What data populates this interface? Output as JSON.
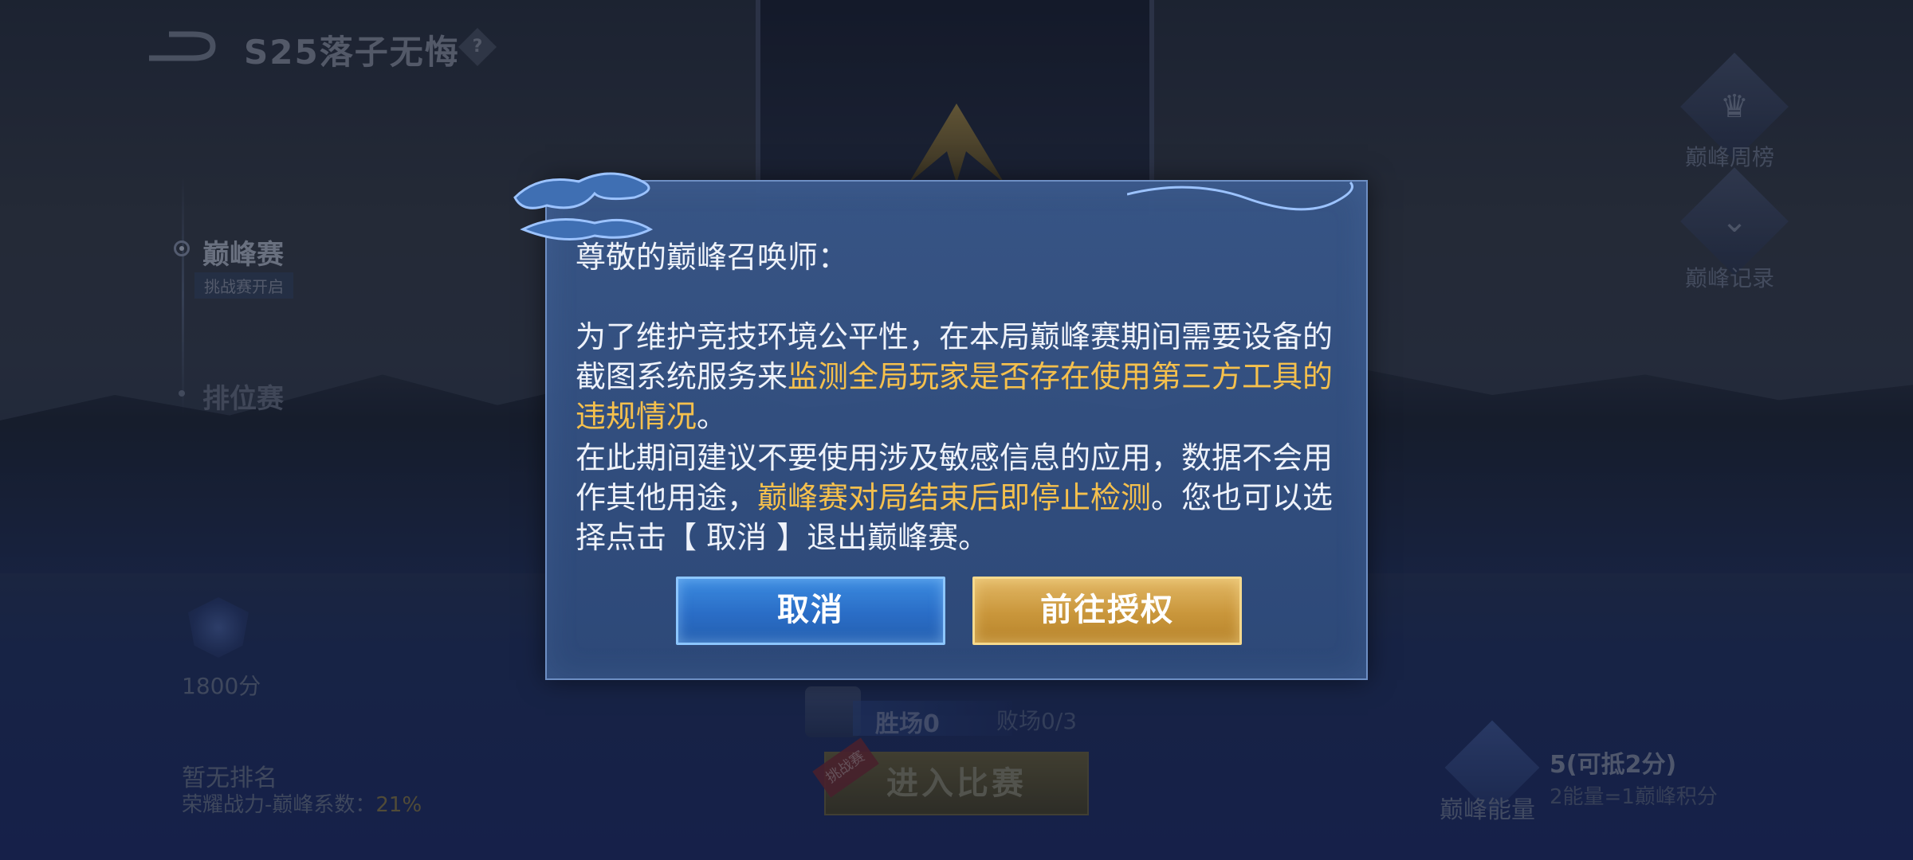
{
  "header": {
    "season_title": "S25落子无悔",
    "help_glyph": "?"
  },
  "modes": {
    "peak": "巅峰赛",
    "peak_sub": "挑战赛开启",
    "ranked": "排位赛"
  },
  "profile": {
    "score": "1800分",
    "no_rank": "暂无排名",
    "power_label": "荣耀战力-巅峰系数：",
    "power_pct": "21%"
  },
  "right_panel": {
    "weekly": "巅峰周榜",
    "record": "巅峰记录"
  },
  "match": {
    "wins": "胜场0",
    "losses": "败场0/3",
    "enter_label": "进入比赛",
    "challenge_tag": "挑战赛"
  },
  "energy": {
    "label": "巅峰能量",
    "value": "5(可抵2分)",
    "rule": "2能量=1巅峰积分"
  },
  "dialog": {
    "salutation": "尊敬的巅峰召唤师：",
    "p1_a": "为了维护竞技环境公平性，在本局巅峰赛期间需要设备的截图系统服务来",
    "p1_hl": "监测全局玩家是否存在使用第三方工具的违规情况",
    "p1_b": "。",
    "p2_a": "在此期间建议不要使用涉及敏感信息的应用，数据不会用作其他用途，",
    "p2_hl": "巅峰赛对局结束后即停止检测",
    "p2_b": "。您也可以选择点击【 取消 】退出巅峰赛。",
    "cancel_label": "取消",
    "auth_label": "前往授权"
  },
  "colors": {
    "highlight": "#f5c04d",
    "cancel_button": "#2a6dc6",
    "auth_button": "#c9963b"
  }
}
